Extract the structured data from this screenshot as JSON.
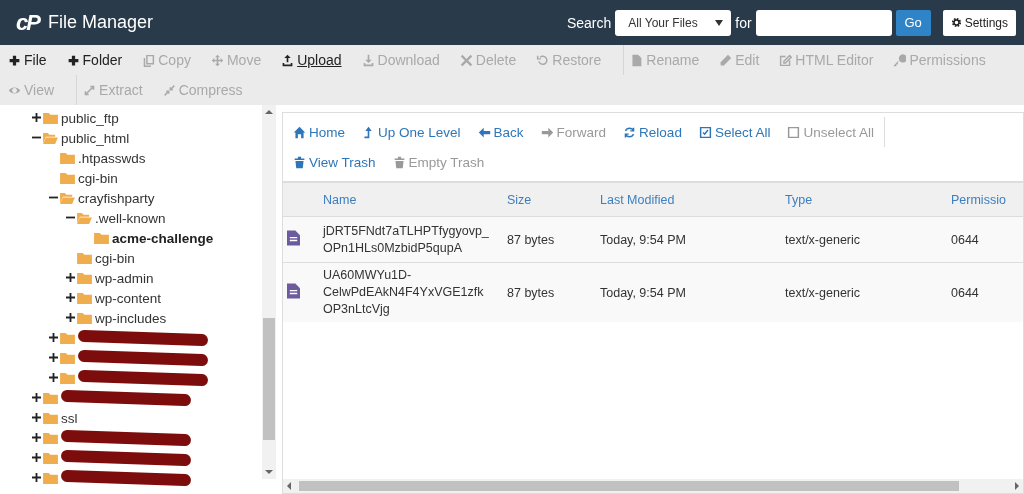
{
  "header": {
    "logo": "cP",
    "title": "File Manager",
    "search_label": "Search",
    "scope": "All Your Files",
    "for_label": "for",
    "go": "Go",
    "settings": "Settings"
  },
  "toolbar": [
    [
      [
        {
          "label": "File",
          "disabled": false,
          "hovered": false
        },
        {
          "label": "Folder",
          "disabled": false,
          "hovered": false
        },
        {
          "label": "Copy",
          "disabled": true,
          "hovered": false
        },
        {
          "label": "Move",
          "disabled": true,
          "hovered": false
        },
        {
          "label": "Upload",
          "disabled": false,
          "hovered": true
        },
        {
          "label": "Download",
          "disabled": true,
          "hovered": false
        },
        {
          "label": "Delete",
          "disabled": true,
          "hovered": false
        },
        {
          "label": "Restore",
          "disabled": true,
          "hovered": false
        }
      ],
      [
        {
          "label": "Rename",
          "disabled": true,
          "hovered": false
        },
        {
          "label": "Edit",
          "disabled": true,
          "hovered": false
        },
        {
          "label": "HTML Editor",
          "disabled": true,
          "hovered": false
        },
        {
          "label": "Permissions",
          "disabled": true,
          "hovered": false
        }
      ]
    ],
    [
      [
        {
          "label": "View",
          "disabled": true,
          "hovered": false
        }
      ],
      [
        {
          "label": "Extract",
          "disabled": true,
          "hovered": false
        },
        {
          "label": "Compress",
          "disabled": true,
          "hovered": false
        }
      ]
    ]
  ],
  "tree": [
    {
      "label": "public_ftp",
      "kind": "branch",
      "expanded": false,
      "selected": false
    },
    {
      "label": "public_html",
      "kind": "branch",
      "expanded": true,
      "selected": false,
      "children": [
        {
          "label": ".htpasswds",
          "kind": "leaf",
          "selected": false
        },
        {
          "label": "cgi-bin",
          "kind": "leaf",
          "selected": false
        },
        {
          "label": "crayfishparty",
          "kind": "branch",
          "expanded": true,
          "selected": false,
          "children": [
            {
              "label": ".well-known",
              "kind": "branch",
              "expanded": true,
              "selected": false,
              "children": [
                {
                  "label": "acme-challenge",
                  "kind": "leaf",
                  "selected": true
                }
              ]
            },
            {
              "label": "cgi-bin",
              "kind": "leaf",
              "selected": false
            },
            {
              "label": "wp-admin",
              "kind": "branch",
              "expanded": false,
              "selected": false
            },
            {
              "label": "wp-content",
              "kind": "branch",
              "expanded": false,
              "selected": false
            },
            {
              "label": "wp-includes",
              "kind": "branch",
              "expanded": false,
              "selected": false
            }
          ]
        },
        {
          "kind": "redacted",
          "expanded": false
        },
        {
          "kind": "redacted",
          "expanded": false
        },
        {
          "kind": "redacted",
          "expanded": false
        }
      ]
    },
    {
      "kind": "redacted",
      "expanded": false
    },
    {
      "label": "ssl",
      "kind": "branch",
      "expanded": false,
      "selected": false
    },
    {
      "kind": "redacted",
      "expanded": false
    },
    {
      "kind": "redacted",
      "expanded": false
    },
    {
      "kind": "redacted",
      "expanded": false
    }
  ],
  "nav": [
    [
      {
        "label": "Home",
        "disabled": false
      },
      {
        "label": "Up One Level",
        "disabled": false
      },
      {
        "label": "Back",
        "disabled": false
      },
      {
        "label": "Forward",
        "disabled": true
      },
      {
        "label": "Reload",
        "disabled": false
      },
      {
        "label": "Select All",
        "disabled": false
      },
      {
        "label": "Unselect All",
        "disabled": true
      }
    ],
    [
      {
        "label": "View Trash",
        "disabled": false
      },
      {
        "label": "Empty Trash",
        "disabled": true
      }
    ]
  ],
  "table": {
    "columns": [
      "Name",
      "Size",
      "Last Modified",
      "Type",
      "Permissio"
    ],
    "rows": [
      {
        "name": "jDRT5FNdt7aTLHPTfygyovp_ OPn1HLs0MzbidP5qupA",
        "size": "87 bytes",
        "modified": "Today, 9:54 PM",
        "type": "text/x-generic",
        "permissions": "0644",
        "selected": false
      },
      {
        "name": "UA60MWYu1D- CelwPdEAkN4F4YxVGE1zfk OP3nLtcVjg",
        "size": "87 bytes",
        "modified": "Today, 9:54 PM",
        "type": "text/x-generic",
        "permissions": "0644",
        "selected": false
      }
    ]
  }
}
